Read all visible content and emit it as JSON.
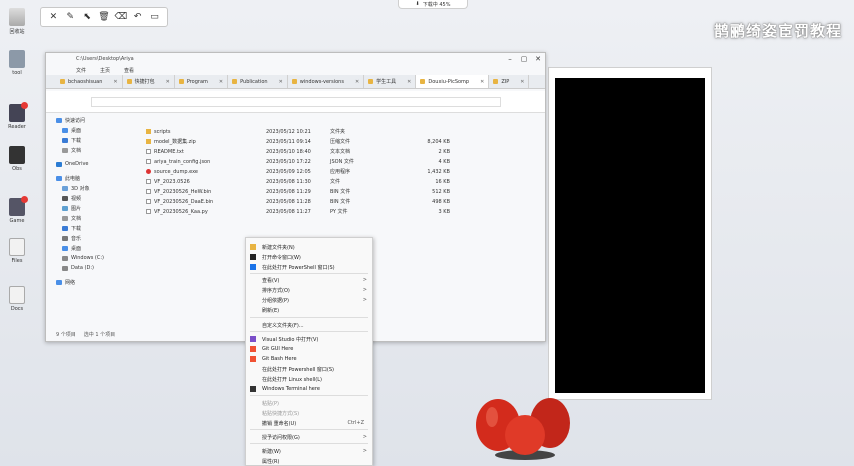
{
  "top_pill": {
    "label": "下载中 45%"
  },
  "watermark": {
    "text": "鹊鹂绮姿宦罚教程"
  },
  "desktop": {
    "icons": [
      {
        "label": "回收站"
      },
      {
        "label": "tool"
      },
      {
        "label": "Reader"
      },
      {
        "label": "Obs"
      },
      {
        "label": "Game"
      },
      {
        "label": "Files"
      },
      {
        "label": "Docs"
      }
    ]
  },
  "explorer": {
    "title": "C:\\Users\\Desktop\\Ariya",
    "menu": [
      "文件",
      "主页",
      "查看"
    ],
    "tabs": [
      {
        "label": "bchaoshisuan"
      },
      {
        "label": "快捷打包"
      },
      {
        "label": "Program"
      },
      {
        "label": "Publication"
      },
      {
        "label": "windows-versions"
      },
      {
        "label": "学生工具"
      },
      {
        "label": "Douxiu-PicSomp"
      },
      {
        "label": "ZIP"
      }
    ],
    "nav": [
      {
        "label": "快速访问"
      },
      {
        "label": "桌面"
      },
      {
        "label": "下载"
      },
      {
        "label": "文档"
      },
      {
        "label": "OneDrive"
      },
      {
        "label": "此电脑"
      },
      {
        "label": "3D 对象"
      },
      {
        "label": "视频"
      },
      {
        "label": "图片"
      },
      {
        "label": "文档"
      },
      {
        "label": "下载"
      },
      {
        "label": "音乐"
      },
      {
        "label": "桌面"
      },
      {
        "label": "Windows (C:)"
      },
      {
        "label": "Data (D:)"
      },
      {
        "label": "网络"
      }
    ],
    "files": [
      {
        "name": "scripts",
        "date": "2023/05/12 10:21",
        "type": "文件夹",
        "size": ""
      },
      {
        "name": "model_数据集.zip",
        "date": "2023/05/11 09:14",
        "type": "压缩文件",
        "size": "8,204 KB"
      },
      {
        "name": "README.txt",
        "date": "2023/05/10 18:40",
        "type": "文本文档",
        "size": "2 KB"
      },
      {
        "name": "ariya_train_config.json",
        "date": "2023/05/10 17:22",
        "type": "JSON 文件",
        "size": "4 KB"
      },
      {
        "name": "source_dump.exe",
        "date": "2023/05/09 12:05",
        "type": "应用程序",
        "size": "1,432 KB"
      },
      {
        "name": "VF_2023.0526",
        "date": "2023/05/08 11:30",
        "type": "文件",
        "size": "16 KB"
      },
      {
        "name": "VF_20230526_HeW.bin",
        "date": "2023/05/08 11:29",
        "type": "BIN 文件",
        "size": "512 KB"
      },
      {
        "name": "VF_20230526_DaaE.bin",
        "date": "2023/05/08 11:28",
        "type": "BIN 文件",
        "size": "498 KB"
      },
      {
        "name": "VF_20230526_Kaa.py",
        "date": "2023/05/08 11:27",
        "type": "PY 文件",
        "size": "3 KB"
      }
    ],
    "status": {
      "count": "9 个项目",
      "selected": "选中 1 个项目"
    }
  },
  "context_menu": [
    {
      "label": "新建文件夹(N)",
      "arrow": "",
      "shortcut": ""
    },
    {
      "label": "打开命令窗口(W)",
      "arrow": "",
      "shortcut": ""
    },
    {
      "label": "在此处打开 PowerShell 窗口(S)",
      "arrow": "",
      "shortcut": ""
    },
    {
      "label": "查看(V)",
      "arrow": ">",
      "shortcut": ""
    },
    {
      "label": "排序方式(O)",
      "arrow": ">",
      "shortcut": ""
    },
    {
      "label": "分组依据(P)",
      "arrow": ">",
      "shortcut": ""
    },
    {
      "label": "刷新(E)",
      "arrow": "",
      "shortcut": ""
    },
    {
      "label": "自定义文件夹(F)...",
      "arrow": "",
      "shortcut": ""
    },
    {
      "label": "Visual Studio 中打开(V)",
      "arrow": "",
      "shortcut": ""
    },
    {
      "label": "Git GUI Here",
      "arrow": "",
      "shortcut": ""
    },
    {
      "label": "Git Bash Here",
      "arrow": "",
      "shortcut": ""
    },
    {
      "label": "在此处打开 Powershell 窗口(S)",
      "arrow": "",
      "shortcut": ""
    },
    {
      "label": "在此处打开 Linux shell(L)",
      "arrow": "",
      "shortcut": ""
    },
    {
      "label": "Windows Terminal here",
      "arrow": "",
      "shortcut": ""
    },
    {
      "label": "粘贴(P)",
      "arrow": "",
      "shortcut": ""
    },
    {
      "label": "粘贴快捷方式(S)",
      "arrow": "",
      "shortcut": ""
    },
    {
      "label": "撤销 重命名(U)",
      "arrow": "",
      "shortcut": "Ctrl+Z"
    },
    {
      "label": "授予访问权限(G)",
      "arrow": ">",
      "shortcut": ""
    },
    {
      "label": "新建(W)",
      "arrow": ">",
      "shortcut": ""
    },
    {
      "label": "属性(R)",
      "arrow": "",
      "shortcut": ""
    }
  ],
  "colors": {
    "folder": "#e8b442",
    "accent": "#1a73e8",
    "figure": "#d32b1c",
    "badge": "#e53935"
  }
}
